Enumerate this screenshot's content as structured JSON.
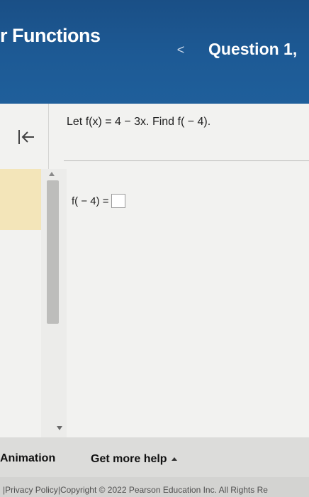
{
  "header": {
    "title": "r Functions",
    "prev_icon": "chevron-left-icon",
    "prev_glyph": "<",
    "question_label": "Question 1,"
  },
  "sidebar": {
    "collapse_icon": "collapse-left-icon"
  },
  "question": {
    "prompt": "Let f(x) = 4 − 3x. Find f( − 4)."
  },
  "answer": {
    "label": "f( − 4) =",
    "value": ""
  },
  "footer": {
    "animation_label": "Animation",
    "help_label": "Get more help",
    "help_icon": "caret-up-icon"
  },
  "legal": {
    "privacy": "Privacy Policy",
    "separator": "|",
    "copyright": "Copyright © 2022 Pearson Education Inc. All Rights Re"
  }
}
